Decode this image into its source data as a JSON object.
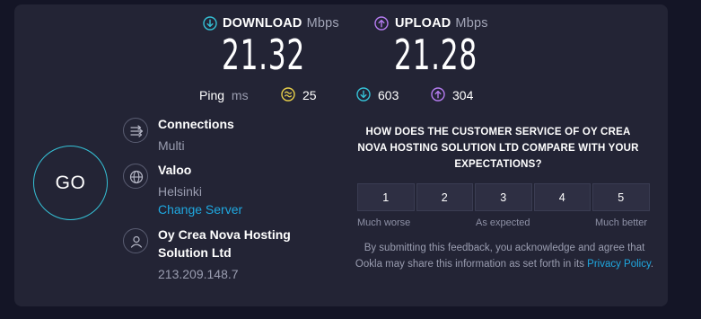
{
  "header": {
    "download": {
      "label": "DOWNLOAD",
      "unit": "Mbps",
      "value": "21.32",
      "icon": "download-arrow-icon",
      "color": "#35c1d6"
    },
    "upload": {
      "label": "UPLOAD",
      "unit": "Mbps",
      "value": "21.28",
      "icon": "upload-arrow-icon",
      "color": "#b57cf0"
    }
  },
  "ping": {
    "label": "Ping",
    "unit": "ms",
    "idle": "25",
    "download": "603",
    "upload": "304",
    "idle_color": "#e8cf4a"
  },
  "go_button": {
    "label": "GO",
    "color": "#35c1d6"
  },
  "connections": {
    "title": "Connections",
    "value": "Multi",
    "icon": "connections-icon"
  },
  "server": {
    "title": "Valoo",
    "location": "Helsinki",
    "change_link": "Change Server",
    "icon": "globe-icon"
  },
  "provider": {
    "name_line1": "Oy Crea Nova Hosting",
    "name_line2": "Solution Ltd",
    "ip": "213.209.148.7",
    "icon": "user-icon"
  },
  "survey": {
    "question": "HOW DOES THE CUSTOMER SERVICE OF OY CREA NOVA HOSTING SOLUTION LTD COMPARE WITH YOUR EXPECTATIONS?",
    "options": [
      "1",
      "2",
      "3",
      "4",
      "5"
    ],
    "low_label": "Much worse",
    "mid_label": "As expected",
    "high_label": "Much better",
    "disclaimer_text": "By submitting this feedback, you acknowledge and agree that Ookla may share this information as set forth in its",
    "privacy_link": "Privacy Policy",
    "disclaimer_end": "."
  }
}
